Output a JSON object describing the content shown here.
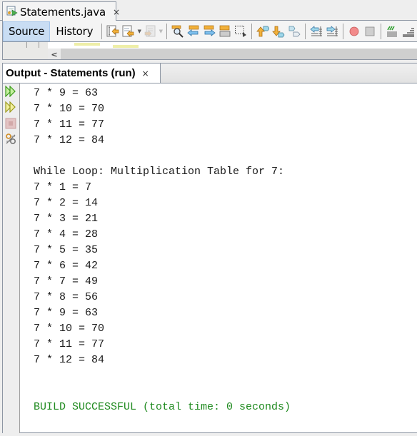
{
  "editor": {
    "tab": {
      "title": "Statements.java",
      "close": "×",
      "icon": "java-file-icon"
    },
    "views": [
      {
        "label": "Source",
        "active": true
      },
      {
        "label": "History",
        "active": false
      }
    ],
    "toolbar_icons": [
      "last-edit-icon",
      "back-icon",
      "forward-icon",
      "find-icon",
      "find-previous-icon",
      "find-next-icon",
      "toggle-highlight-icon",
      "toggle-rect-select-icon",
      "previous-bookmark-icon",
      "next-bookmark-icon",
      "toggle-bookmark-icon",
      "shift-left-icon",
      "shift-right-icon",
      "start-macro-icon",
      "stop-macro-icon",
      "comment-icon",
      "uncomment-icon"
    ],
    "scroll_left": "<"
  },
  "output": {
    "tab": {
      "title": "Output - Statements (run)",
      "close": "×"
    },
    "side_buttons": [
      "rerun-icon",
      "rerun-with-params-icon",
      "stop-icon",
      "settings-icon"
    ],
    "lines": [
      "7 * 9 = 63",
      "7 * 10 = 70",
      "7 * 11 = 77",
      "7 * 12 = 84",
      "",
      "While Loop: Multiplication Table for 7:",
      "7 * 1 = 7",
      "7 * 2 = 14",
      "7 * 3 = 21",
      "7 * 4 = 28",
      "7 * 5 = 35",
      "7 * 6 = 42",
      "7 * 7 = 49",
      "7 * 8 = 56",
      "7 * 9 = 63",
      "7 * 10 = 70",
      "7 * 11 = 77",
      "7 * 12 = 84",
      "",
      "",
      "BUILD SUCCESSFUL (total time: 0 seconds)"
    ],
    "success_color": "#1f8a1f"
  }
}
